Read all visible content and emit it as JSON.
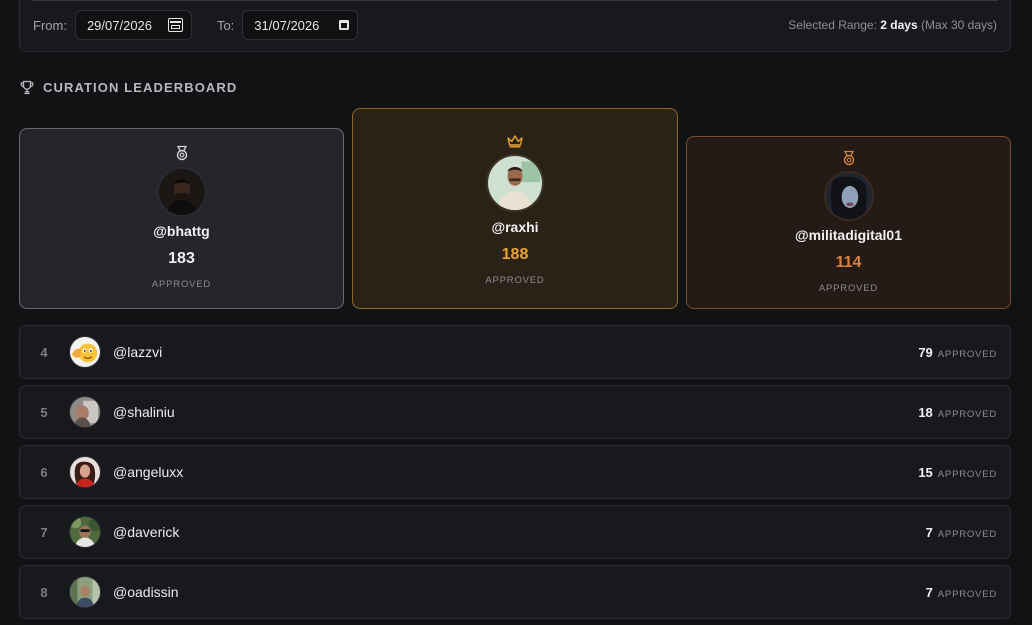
{
  "range": {
    "from_label": "From:",
    "from_value": "29/07/2026",
    "to_label": "To:",
    "to_value": "31/07/2026",
    "selected_prefix": "Selected Range:",
    "selected_value": "2 days",
    "max_note": "(Max 30 days)"
  },
  "section": {
    "title": "CURATION LEADERBOARD",
    "icon": "trophy-icon"
  },
  "podium": {
    "first": {
      "username": "@raxhi",
      "score": "188",
      "label": "APPROVED",
      "badge_icon": "crown-icon",
      "accent": "#e8a33a"
    },
    "second": {
      "username": "@bhattg",
      "score": "183",
      "label": "APPROVED",
      "badge_icon": "medal-icon",
      "accent": "#c9cbd1"
    },
    "third": {
      "username": "@militadigital01",
      "score": "114",
      "label": "APPROVED",
      "badge_icon": "medal-icon",
      "accent": "#d9823d"
    }
  },
  "rows": [
    {
      "rank": "4",
      "username": "@lazzvi",
      "score": "79",
      "label": "APPROVED"
    },
    {
      "rank": "5",
      "username": "@shaliniu",
      "score": "18",
      "label": "APPROVED"
    },
    {
      "rank": "6",
      "username": "@angeluxx",
      "score": "15",
      "label": "APPROVED"
    },
    {
      "rank": "7",
      "username": "@daverick",
      "score": "7",
      "label": "APPROVED"
    },
    {
      "rank": "8",
      "username": "@oadissin",
      "score": "7",
      "label": "APPROVED"
    }
  ]
}
